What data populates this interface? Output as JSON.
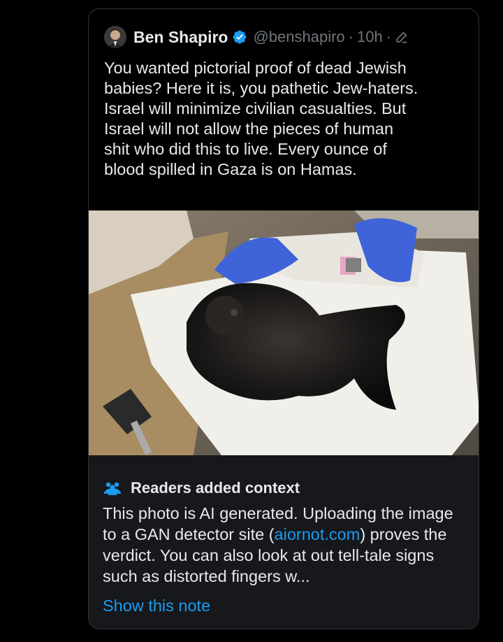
{
  "tweet": {
    "author_name": "Ben Shapiro",
    "handle": "@benshapiro",
    "separator": "·",
    "time": "10h",
    "separator2": "·",
    "verified": true,
    "icons": {
      "verified": "verified-badge-icon",
      "edit": "pencil-edit-icon",
      "avatar": "avatar"
    },
    "text_lines": [
      "You wanted pictorial proof of dead Jewish",
      "babies? Here it is, you pathetic Jew-haters.",
      "Israel will minimize civilian casualties. But",
      "Israel will not allow the pieces of human",
      "shit who did this to live. Every ounce of",
      "blood spilled in Gaza is on Hamas."
    ]
  },
  "media": {
    "type": "photo",
    "description_icon": "photo"
  },
  "community_note": {
    "icon": "people-icon",
    "title": "Readers added context",
    "body_part1": "This photo is AI generated. Uploading the image to a GAN detector site (",
    "link_text": "aiornot.com",
    "body_part2": ") proves the verdict. You can also look at out tell-tale signs such as distorted fingers w...",
    "show_note_label": "Show this note"
  },
  "colors": {
    "background": "#000000",
    "text": "#e7e9ea",
    "secondary_text": "#71767b",
    "accent_blue": "#1d9bf0",
    "note_background": "#16181c",
    "border": "#2f3336"
  }
}
